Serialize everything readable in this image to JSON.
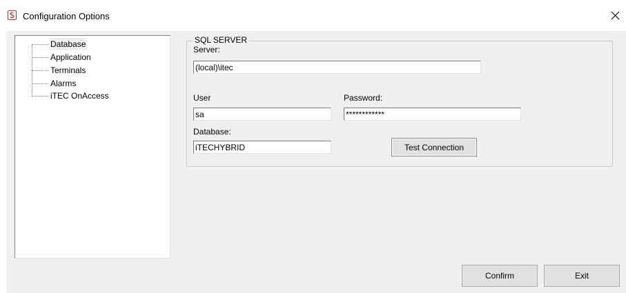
{
  "window": {
    "title": "Configuration Options"
  },
  "tree": {
    "items": [
      {
        "label": "Database",
        "selected": true
      },
      {
        "label": "Application",
        "selected": false
      },
      {
        "label": "Terminals",
        "selected": false
      },
      {
        "label": "Alarms",
        "selected": false
      },
      {
        "label": "iTEC OnAccess",
        "selected": false
      }
    ]
  },
  "sql_server": {
    "group_title": "SQL SERVER",
    "server_label": "Server:",
    "server_value": "(local)\\itec",
    "user_label": "User",
    "user_value": "sa",
    "password_label": "Password:",
    "password_value": "************",
    "database_label": "Database:",
    "database_value": "iTECHYBRID",
    "test_button": "Test Connection"
  },
  "footer": {
    "confirm_button": "Confirm",
    "exit_button": "Exit"
  },
  "colors": {
    "dialog_bg": "#f0f0f0",
    "icon_red": "#b03030"
  }
}
